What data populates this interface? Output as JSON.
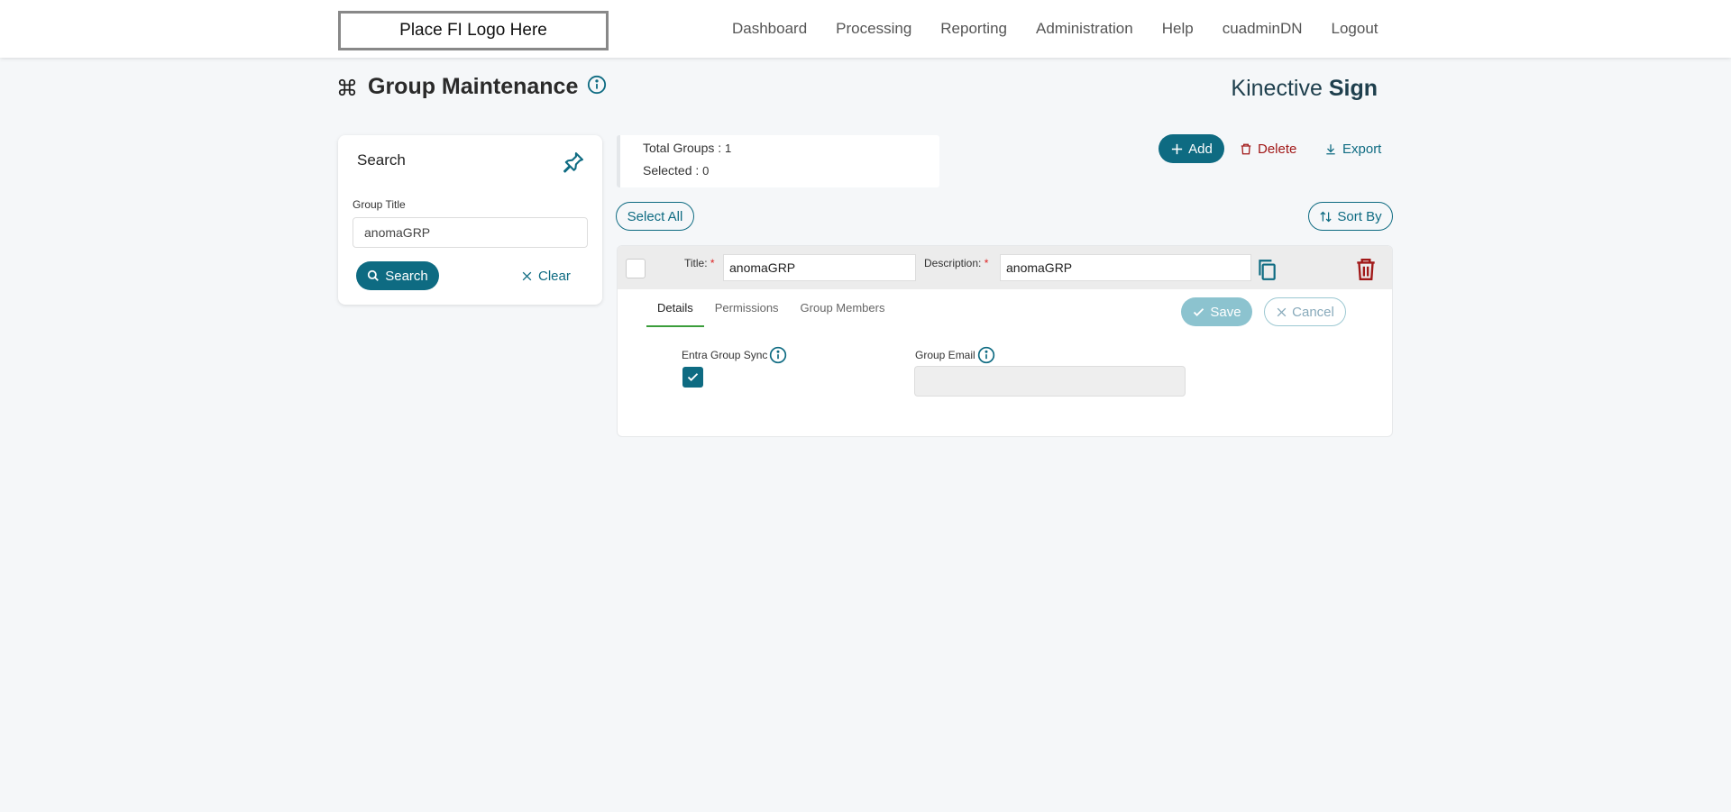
{
  "header": {
    "logo_text": "Place FI Logo Here",
    "nav": [
      "Dashboard",
      "Processing",
      "Reporting",
      "Administration",
      "Help",
      "cuadminDN",
      "Logout"
    ]
  },
  "page": {
    "title": "Group Maintenance",
    "brand_light": "Kinective",
    "brand_bold": "Sign"
  },
  "search": {
    "heading": "Search",
    "group_title_label": "Group Title",
    "group_title_value": "anomaGRP",
    "search_button": "Search",
    "clear_button": "Clear"
  },
  "totals": {
    "total_label": "Total Groups : ",
    "total_value": "1",
    "selected_label": "Selected : ",
    "selected_value": "0"
  },
  "actions": {
    "add": "Add",
    "delete": "Delete",
    "export": "Export",
    "select_all": "Select All",
    "sort_by": "Sort By"
  },
  "group": {
    "title_label": "Title:",
    "title_value": "anomaGRP",
    "description_label": "Description:",
    "description_value": "anomaGRP",
    "required_mark": "*",
    "tabs": [
      "Details",
      "Permissions",
      "Group Members"
    ],
    "save": "Save",
    "cancel": "Cancel",
    "entra_sync_label": "Entra Group Sync",
    "entra_sync_checked": true,
    "group_email_label": "Group Email",
    "group_email_value": ""
  },
  "colors": {
    "primary": "#0e6b82",
    "danger": "#a11818",
    "tab_active": "#3b9d3b"
  }
}
